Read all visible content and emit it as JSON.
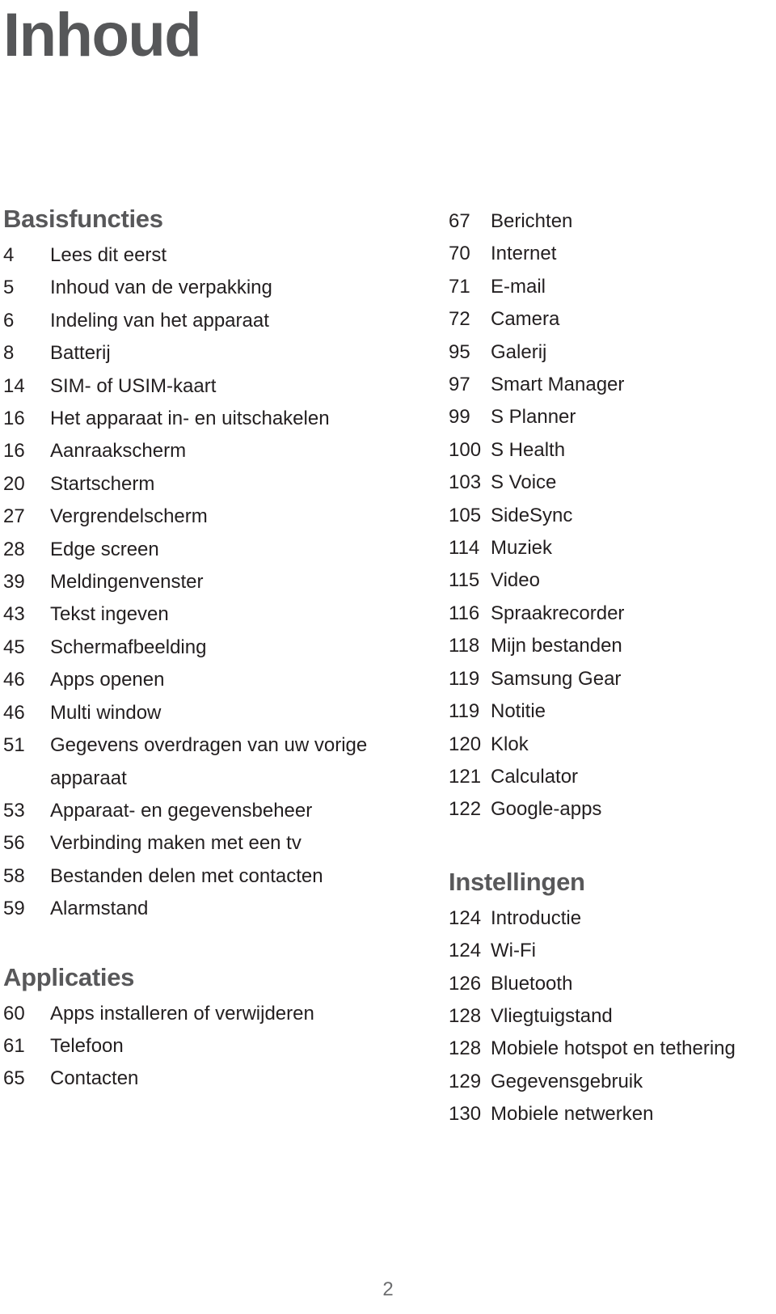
{
  "document": {
    "title": "Inhoud",
    "page_number": "2"
  },
  "left_column": {
    "sections": [
      {
        "heading": "Basisfuncties",
        "entries": [
          {
            "page": "4",
            "label": "Lees dit eerst"
          },
          {
            "page": "5",
            "label": "Inhoud van de verpakking"
          },
          {
            "page": "6",
            "label": "Indeling van het apparaat"
          },
          {
            "page": "8",
            "label": "Batterij"
          },
          {
            "page": "14",
            "label": "SIM- of USIM-kaart"
          },
          {
            "page": "16",
            "label": "Het apparaat in- en uitschakelen"
          },
          {
            "page": "16",
            "label": "Aanraakscherm"
          },
          {
            "page": "20",
            "label": "Startscherm"
          },
          {
            "page": "27",
            "label": "Vergrendelscherm"
          },
          {
            "page": "28",
            "label": "Edge screen"
          },
          {
            "page": "39",
            "label": "Meldingenvenster"
          },
          {
            "page": "43",
            "label": "Tekst ingeven"
          },
          {
            "page": "45",
            "label": "Schermafbeelding"
          },
          {
            "page": "46",
            "label": "Apps openen"
          },
          {
            "page": "46",
            "label": "Multi window"
          },
          {
            "page": "51",
            "label": "Gegevens overdragen van uw vorige apparaat"
          },
          {
            "page": "53",
            "label": "Apparaat- en gegevensbeheer"
          },
          {
            "page": "56",
            "label": "Verbinding maken met een tv"
          },
          {
            "page": "58",
            "label": "Bestanden delen met contacten"
          },
          {
            "page": "59",
            "label": "Alarmstand"
          }
        ]
      },
      {
        "heading": "Applicaties",
        "entries": [
          {
            "page": "60",
            "label": "Apps installeren of verwijderen"
          },
          {
            "page": "61",
            "label": "Telefoon"
          },
          {
            "page": "65",
            "label": "Contacten"
          }
        ]
      }
    ]
  },
  "right_column": {
    "sections": [
      {
        "heading": "",
        "entries": [
          {
            "page": "67",
            "label": "Berichten"
          },
          {
            "page": "70",
            "label": "Internet"
          },
          {
            "page": "71",
            "label": "E-mail"
          },
          {
            "page": "72",
            "label": "Camera"
          },
          {
            "page": "95",
            "label": "Galerij"
          },
          {
            "page": "97",
            "label": "Smart Manager"
          },
          {
            "page": "99",
            "label": "S Planner"
          },
          {
            "page": "100",
            "label": "S Health"
          },
          {
            "page": "103",
            "label": "S Voice"
          },
          {
            "page": "105",
            "label": "SideSync"
          },
          {
            "page": "114",
            "label": "Muziek"
          },
          {
            "page": "115",
            "label": "Video"
          },
          {
            "page": "116",
            "label": "Spraakrecorder"
          },
          {
            "page": "118",
            "label": "Mijn bestanden"
          },
          {
            "page": "119",
            "label": "Samsung Gear"
          },
          {
            "page": "119",
            "label": "Notitie"
          },
          {
            "page": "120",
            "label": "Klok"
          },
          {
            "page": "121",
            "label": "Calculator"
          },
          {
            "page": "122",
            "label": "Google-apps"
          }
        ]
      },
      {
        "heading": "Instellingen",
        "entries": [
          {
            "page": "124",
            "label": "Introductie"
          },
          {
            "page": "124",
            "label": "Wi-Fi"
          },
          {
            "page": "126",
            "label": "Bluetooth"
          },
          {
            "page": "128",
            "label": "Vliegtuigstand"
          },
          {
            "page": "128",
            "label": "Mobiele hotspot en tethering"
          },
          {
            "page": "129",
            "label": "Gegevensgebruik"
          },
          {
            "page": "130",
            "label": "Mobiele netwerken"
          }
        ]
      }
    ]
  },
  "colors": {
    "heading": "#58585a",
    "body_text": "#231f20",
    "page_number": "#6d6e70",
    "background": "#ffffff"
  }
}
